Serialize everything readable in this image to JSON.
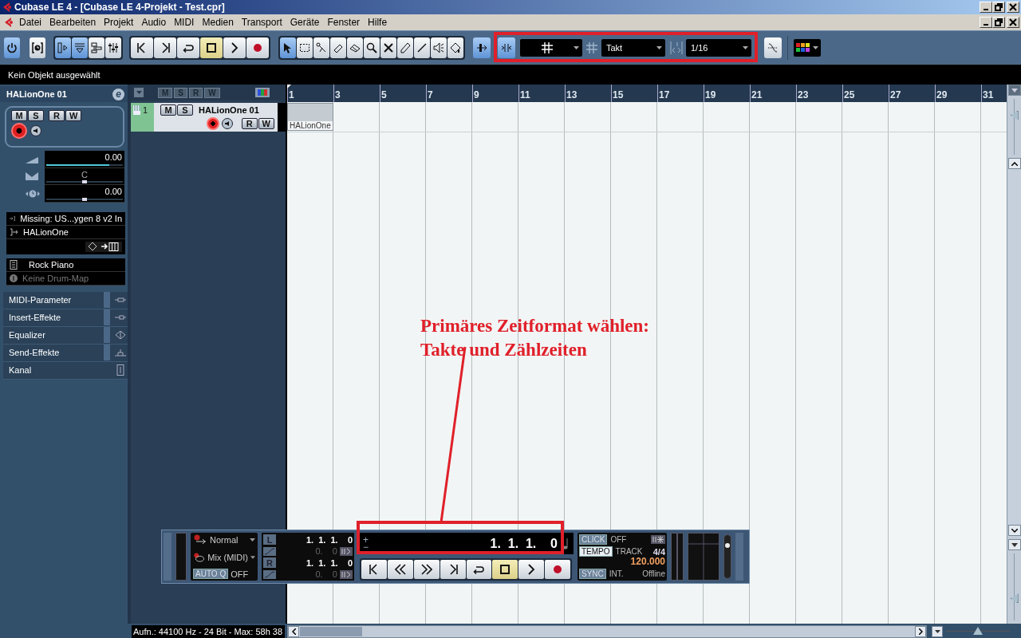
{
  "window": {
    "title": "Cubase LE 4 - [Cubase LE 4-Projekt - Test.cpr]"
  },
  "menu": [
    "Datei",
    "Bearbeiten",
    "Projekt",
    "Audio",
    "MIDI",
    "Medien",
    "Transport",
    "Geräte",
    "Fenster",
    "Hilfe"
  ],
  "toolbar": {
    "project": [
      {
        "kind": "power",
        "selected": true
      },
      {
        "kind": "constrain",
        "selected": false
      }
    ],
    "views": [
      {
        "kind": "inspector",
        "selected": true
      },
      {
        "kind": "info-line",
        "selected": true
      },
      {
        "kind": "overview",
        "selected": false
      },
      {
        "kind": "mixer",
        "selected": false
      }
    ],
    "transport": [
      {
        "kind": "start",
        "selected": false
      },
      {
        "kind": "end",
        "selected": false
      },
      {
        "kind": "cycle",
        "selected": false
      },
      {
        "kind": "stop",
        "selected": true
      },
      {
        "kind": "play",
        "selected": false
      },
      {
        "kind": "record",
        "selected": false
      }
    ],
    "tools": [
      {
        "kind": "pointer",
        "selected": true
      },
      {
        "kind": "range",
        "selected": false
      },
      {
        "kind": "split",
        "selected": false
      },
      {
        "kind": "glue",
        "selected": false
      },
      {
        "kind": "erase",
        "selected": false
      },
      {
        "kind": "zoom",
        "selected": false
      },
      {
        "kind": "mute",
        "selected": false
      },
      {
        "kind": "draw",
        "selected": false
      },
      {
        "kind": "line",
        "selected": false
      },
      {
        "kind": "playtool",
        "selected": false
      },
      {
        "kind": "color",
        "selected": false
      }
    ],
    "autoscroll": {
      "selected": true
    },
    "snap": {
      "selected": true
    },
    "grid": "Takt",
    "quantize": "1/16",
    "zero_crossing": {
      "selected": false
    }
  },
  "info_line": "Kein Objekt ausgewählt",
  "inspector": {
    "track_name": "HALionOne 01",
    "edit_button": "e",
    "buttons": [
      {
        "label": "M",
        "selected": false
      },
      {
        "label": "S",
        "selected": false
      },
      {
        "label": "R",
        "selected": false
      },
      {
        "label": "W",
        "selected": false
      }
    ],
    "record_enabled": true,
    "monitor": false,
    "parameters": [
      {
        "kind": "volume",
        "value": "0.00",
        "level": 0.82
      },
      {
        "kind": "pan",
        "value": "C",
        "level": 0.5
      },
      {
        "kind": "delay",
        "value": "0.00",
        "level": 0.5
      }
    ],
    "routing": [
      {
        "kind": "input",
        "label": "Missing: US...ygen 8 v2 In"
      },
      {
        "kind": "output",
        "label": "HALionOne"
      }
    ],
    "program": [
      {
        "kind": "program",
        "label": "Rock Piano",
        "disabled": false
      },
      {
        "kind": "drum-map",
        "label": "Keine Drum-Map",
        "disabled": true
      }
    ],
    "sections": [
      {
        "kind": "midi",
        "label": "MIDI-Parameter"
      },
      {
        "kind": "insert",
        "label": "Insert-Effekte"
      },
      {
        "kind": "eq",
        "label": "Equalizer"
      },
      {
        "kind": "send",
        "label": "Send-Effekte"
      },
      {
        "kind": "channel",
        "label": "Kanal"
      }
    ]
  },
  "track_list": {
    "header_buttons": [
      "M",
      "S",
      "R",
      "W"
    ],
    "tracks": [
      {
        "number": "1",
        "name": "HALionOne 01",
        "buttons": [
          {
            "label": "M",
            "selected": false
          },
          {
            "label": "S",
            "selected": false
          },
          {
            "label": "R",
            "selected": false
          },
          {
            "label": "W",
            "selected": false
          }
        ],
        "record_enabled": true,
        "monitor": false
      }
    ]
  },
  "ruler": [
    "1",
    "3",
    "5",
    "7",
    "9",
    "11",
    "13",
    "15",
    "17",
    "19",
    "21",
    "23",
    "25",
    "27",
    "29",
    "31"
  ],
  "parts": [
    {
      "name": "HALionOne"
    }
  ],
  "transport": {
    "record_mode": "Normal",
    "cycle_mode": "Mix (MIDI)",
    "auto_quantize": {
      "label": "AUTO Q",
      "value": "OFF",
      "on": false
    },
    "left_locator": {
      "label": "L",
      "position": "1.  1.  1.    0",
      "offset": "0.    0"
    },
    "right_locator": {
      "label": "R",
      "position": "1.  1.  1.    0",
      "offset": "0.    0"
    },
    "position": "1.  1.  1.    0",
    "plus": "+",
    "minus": "−",
    "buttons": [
      {
        "kind": "start",
        "selected": false
      },
      {
        "kind": "rewind",
        "selected": false
      },
      {
        "kind": "forward",
        "selected": false
      },
      {
        "kind": "end",
        "selected": false
      },
      {
        "kind": "cycle",
        "selected": false
      },
      {
        "kind": "stop",
        "selected": true
      },
      {
        "kind": "play",
        "selected": false
      },
      {
        "kind": "record",
        "selected": false
      }
    ],
    "click": {
      "label": "CLICK",
      "value": "OFF",
      "on": false
    },
    "tempo": {
      "label": "TEMPO",
      "mode": "TRACK",
      "signature": "4/4",
      "bpm": "120.000",
      "on": true
    },
    "sync": {
      "label": "SYNC",
      "source": "INT.",
      "status": "Offline",
      "on": false
    }
  },
  "sliders": {
    "track_height": {
      "level": 0.75
    },
    "vertical_zoom": {
      "level": 0.3
    },
    "horizontal_zoom": {
      "level": 0.5
    },
    "master": {
      "level": 0.8
    }
  },
  "status_bar": "Aufn.: 44100 Hz - 24 Bit - Max: 58h 38",
  "annotation": {
    "lines": [
      "Primäres Zeitformat wählen:",
      "Takte und Zählzeiten"
    ]
  }
}
